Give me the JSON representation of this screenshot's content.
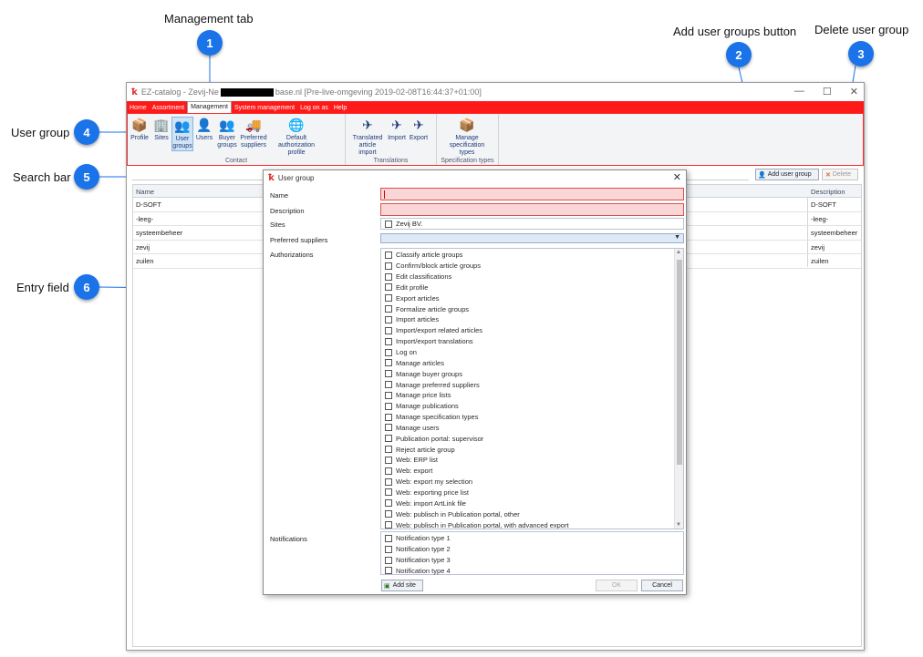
{
  "annotations": {
    "management_tab": "Management tab",
    "add_user_groups": "Add user groups button",
    "delete_user_group": "Delete user group",
    "user_group": "User group",
    "search_bar": "Search bar",
    "entry_field": "Entry field",
    "badge1": "1",
    "badge2": "2",
    "badge3": "3",
    "badge4": "4",
    "badge5": "5",
    "badge6": "6"
  },
  "window": {
    "title_prefix": "EZ-catalog - Zevij-Ne",
    "title_suffix": "base.nl [Pre-live-omgeving 2019-02-08T16:44:37+01:00]",
    "controls": [
      "—",
      "☐",
      "✕"
    ]
  },
  "menubar": [
    "Home",
    "Assortment",
    "Management",
    "System management",
    "Log on as",
    "Help"
  ],
  "ribbon": {
    "contact": {
      "label": "Contact",
      "buttons": [
        {
          "label": "Profile"
        },
        {
          "label": "Sites"
        },
        {
          "label": "User groups"
        },
        {
          "label": "Users"
        },
        {
          "label": "Buyer groups"
        },
        {
          "label": "Preferred suppliers"
        },
        {
          "label": "Default authorization profile"
        }
      ]
    },
    "translations": {
      "label": "Translations",
      "buttons": [
        {
          "label": "Translated article import"
        },
        {
          "label": "Import"
        },
        {
          "label": "Export"
        }
      ]
    },
    "specification": {
      "label": "Specification types",
      "buttons": [
        {
          "label": "Manage specification types"
        }
      ]
    }
  },
  "toolbar": {
    "add_user_group": "Add user group",
    "delete": "Delete"
  },
  "grid": {
    "columns": [
      "Name",
      "Description"
    ],
    "rows": [
      {
        "name": "D-SOFT",
        "description": "D-SOFT"
      },
      {
        "name": "-leeg-",
        "description": "-leeg-"
      },
      {
        "name": "systeembeheer",
        "description": "systeembeheer"
      },
      {
        "name": "zevij",
        "description": "zevij"
      },
      {
        "name": "zuilen",
        "description": "zuilen"
      }
    ]
  },
  "dialog": {
    "title": "User group",
    "close": "✕",
    "labels": {
      "name": "Name",
      "description": "Description",
      "sites": "Sites",
      "preferred_suppliers": "Preferred suppliers",
      "authorizations": "Authorizations",
      "notifications": "Notifications"
    },
    "name_value": "",
    "description_value": "",
    "site_option": "Zevij BV.",
    "authorizations": [
      "Classify article groups",
      "Confirm/block article groups",
      "Edit classifications",
      "Edit profile",
      "Export articles",
      "Formalize article groups",
      "Import articles",
      "Import/export related articles",
      "Import/export translations",
      "Log on",
      "Manage articles",
      "Manage buyer groups",
      "Manage preferred suppliers",
      "Manage price lists",
      "Manage publications",
      "Manage specification types",
      "Manage users",
      "Publication portal: supervisor",
      "Reject article group",
      "Web: ERP list",
      "Web: export",
      "Web: export my selection",
      "Web: exporting price list",
      "Web: import ArtLink file",
      "Web: publisch in Publication portal, other",
      "Web: publisch in Publication portal, with advanced export"
    ],
    "notifications": [
      "Notification type 1",
      "Notification type 2",
      "Notification type 3",
      "Notification type 4"
    ],
    "buttons": {
      "add_site": "Add site",
      "ok": "OK",
      "cancel": "Cancel"
    }
  },
  "colors": {
    "menubar": "#ff1a1a",
    "badge": "#1a73e8",
    "invalid_field": "#fbd6d6"
  }
}
